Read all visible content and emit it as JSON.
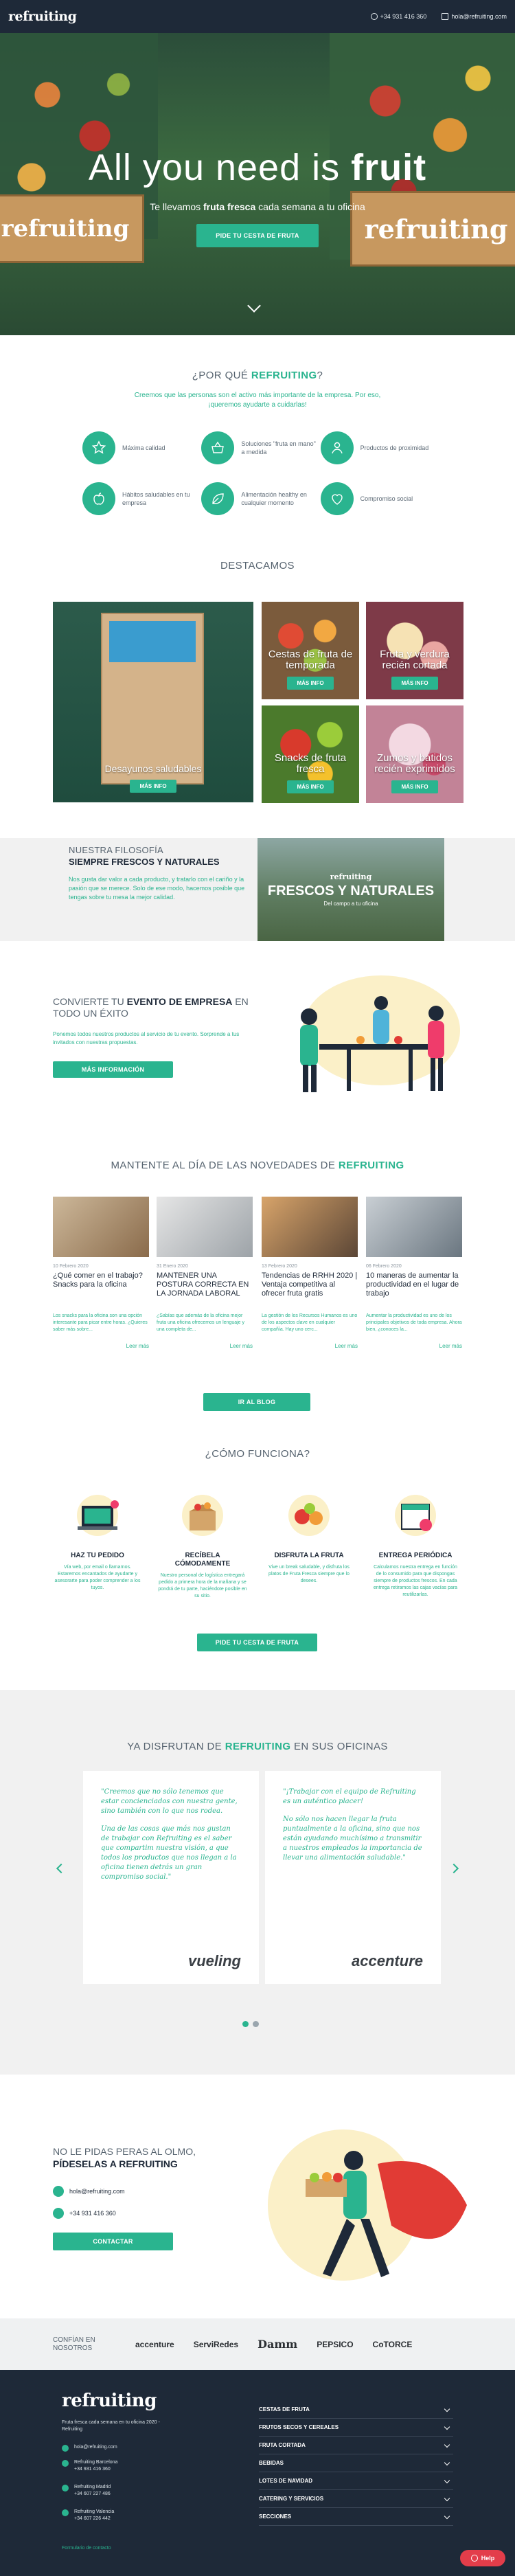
{
  "colors": {
    "accent": "#2ab48f",
    "navy": "#1e2938",
    "light_bg": "#f1f1f1",
    "help": "#e33d4a"
  },
  "topbar": {
    "logo": "refruiting",
    "phone": "+34 931 416 360",
    "email": "hola@refruiting.com"
  },
  "hero": {
    "title_pre": "All you need is ",
    "title_bold": "fruit",
    "sub_pre": "Te llevamos ",
    "sub_bold": "fruta fresca",
    "sub_post": " cada semana a tu oficina",
    "cta": "PIDE TU CESTA DE FRUTA",
    "crate_text": "refruiting"
  },
  "why": {
    "title_pre": "¿POR QUÉ ",
    "title_bold": "REFRUITING",
    "title_post": "?",
    "lead": "Creemos que las personas son el activo más importante de la empresa. Por eso, ¡queremos ayudarte a cuidarlas!",
    "features": [
      {
        "icon": "star-icon",
        "label": "Máxima calidad"
      },
      {
        "icon": "basket-icon",
        "label": "Soluciones \"fruta en mano\" a medida"
      },
      {
        "icon": "people-icon",
        "label": "Productos de proximidad"
      },
      {
        "icon": "apple-icon",
        "label": "Hábitos saludables en tu empresa"
      },
      {
        "icon": "leaf-icon",
        "label": "Alimentación healthy en cualquier momento"
      },
      {
        "icon": "heart-icon",
        "label": "Compromiso social"
      }
    ]
  },
  "featured": {
    "title": "DESTACAMOS",
    "btn": "MÁS INFO",
    "items": [
      {
        "title": "Desayunos saludables"
      },
      {
        "title": "Cestas de fruta de temporada"
      },
      {
        "title": "Fruta y verdura recién cortada"
      },
      {
        "title": "Snacks de fruta fresca"
      },
      {
        "title": "Zumos y batidos recién exprimidos"
      }
    ]
  },
  "philosophy": {
    "kicker": "NUESTRA FILOSOFÍA",
    "headline": "SIEMPRE FRESCOS Y NATURALES",
    "body": "Nos gusta dar valor a cada producto, y tratarlo con el cariño y la pasión que se merece. Solo de ese modo, hacemos posible que tengas sobre tu mesa la mejor calidad.",
    "img_logo": "refruiting",
    "img_title": "FRESCOS Y NATURALES",
    "img_sub": "Del campo a tu oficina"
  },
  "event": {
    "pre": "CONVIERTE TU ",
    "bold": "EVENTO DE EMPRESA",
    "post": " EN TODO UN ÉXITO",
    "body": "Ponemos todos nuestros productos al servicio de tu evento. Sorprende a tus invitados con nuestras propuestas.",
    "cta": "MÁS INFORMACIÓN"
  },
  "blog": {
    "title_pre": "MANTENTE AL DÍA DE LAS NOVEDADES DE ",
    "title_bold": "REFRUITING",
    "read_more": "Leer más",
    "cta": "IR AL BLOG",
    "posts": [
      {
        "date": "10 Febrero 2020",
        "title": "¿Qué comer en el trabajo? Snacks para la oficina",
        "excerpt": "Los snacks para la oficina son una opción interesante para picar entre horas. ¿Quieres saber más sobre..."
      },
      {
        "date": "31 Enero 2020",
        "title": "MANTENER UNA POSTURA CORRECTA EN LA JORNADA LABORAL",
        "excerpt": "¿Sabías que además de la oficina mejor fruta una oficina ofrecemos un lenguaje y una completa de..."
      },
      {
        "date": "13 Febrero 2020",
        "title": "Tendencias de RRHH 2020 | Ventaja competitiva al ofrecer fruta gratis",
        "excerpt": "La gestión de los Recursos Humanos es uno de los aspectos clave en cualquier compañía. Hay uno cerc..."
      },
      {
        "date": "06 Febrero 2020",
        "title": "10 maneras de aumentar la productividad en el lugar de trabajo",
        "excerpt": "Aumentar la productividad es uno de los principales objetivos de toda empresa. Ahora bien, ¿conoces la..."
      }
    ]
  },
  "how": {
    "title": "¿CÓMO FUNCIONA?",
    "cta": "PIDE TU CESTA DE FRUTA",
    "steps": [
      {
        "title": "HAZ TU PEDIDO",
        "desc": "Vía web, por email o llamarnos. Estaremos encantados de ayudarte y asesorarte para poder comprender a los tuyos."
      },
      {
        "title": "RECÍBELA CÓMODAMENTE",
        "desc": "Nuestro personal de logística entregará pedido a primera hora de la mañana y se pondrá de tu parte, haciéndote posible en su sitio."
      },
      {
        "title": "DISFRUTA LA FRUTA",
        "desc": "Vive un break saludable, y disfruta los platos de Fruta Fresca siempre que lo desees."
      },
      {
        "title": "ENTREGA PERIÓDICA",
        "desc": "Calculamos nuestra entrega en función de lo consumido para que dispongas siempre de productos frescos. En cada entrega retiramos las cajas vacías para reutilizarlas."
      }
    ]
  },
  "testimonials": {
    "title_pre": "YA DISFRUTAN DE ",
    "title_bold": "REFRUITING",
    "title_post": " EN SUS OFICINAS",
    "cards": [
      {
        "p1": "\"Creemos que no sólo tenemos que estar concienciados con nuestra gente, sino también con lo que nos rodea.",
        "p2": "Una de las cosas que más nos gustan de trabajar con Refruiting es el saber que compartim nuestra visión, a que todos los productos que nos llegan a la oficina tienen detrás un gran compromiso social.\"",
        "brand": "vueling"
      },
      {
        "p1": "\"¡Trabajar con el equipo de Refruiting es un auténtico placer!",
        "p2": "No sólo nos hacen llegar la fruta puntualmente a la oficina, sino que nos están ayudando muchísimo a transmitir a nuestros empleados la importancia de llevar una alimentación saludable.\"",
        "brand": "accenture"
      }
    ]
  },
  "contact": {
    "line1": "NO LE PIDAS PERAS AL OLMO,",
    "line2": "PÍDESELAS A REFRUITING",
    "email": "hola@refruiting.com",
    "phone": "+34 931 416 360",
    "cta": "CONTACTAR"
  },
  "clients": {
    "label": "CONFÍAN EN NOSOTROS",
    "logos": [
      "accenture",
      "ServiRedes",
      "Damm",
      "PEPSICO",
      "CoTORCE"
    ]
  },
  "footer": {
    "logo": "refruiting",
    "tagline": "Fruta fresca cada semana en tu oficina 2020 - Refruiting",
    "lines": [
      "hola@refruiting.com",
      "Refruiting Barcelona",
      "+34 931 416 360",
      "Refruiting Madrid",
      "+34 607 227 486",
      "Refruiting Valencia",
      "+34 607 226 442"
    ],
    "form_link": "Formulario de contacto",
    "menu": [
      "CESTAS DE FRUTA",
      "FRUTOS SECOS Y CEREALES",
      "FRUTA CORTADA",
      "BEBIDAS",
      "LOTES DE NAVIDAD",
      "CATERING Y SERVICIOS",
      "SECCIONES"
    ]
  },
  "help": {
    "label": "Help"
  }
}
